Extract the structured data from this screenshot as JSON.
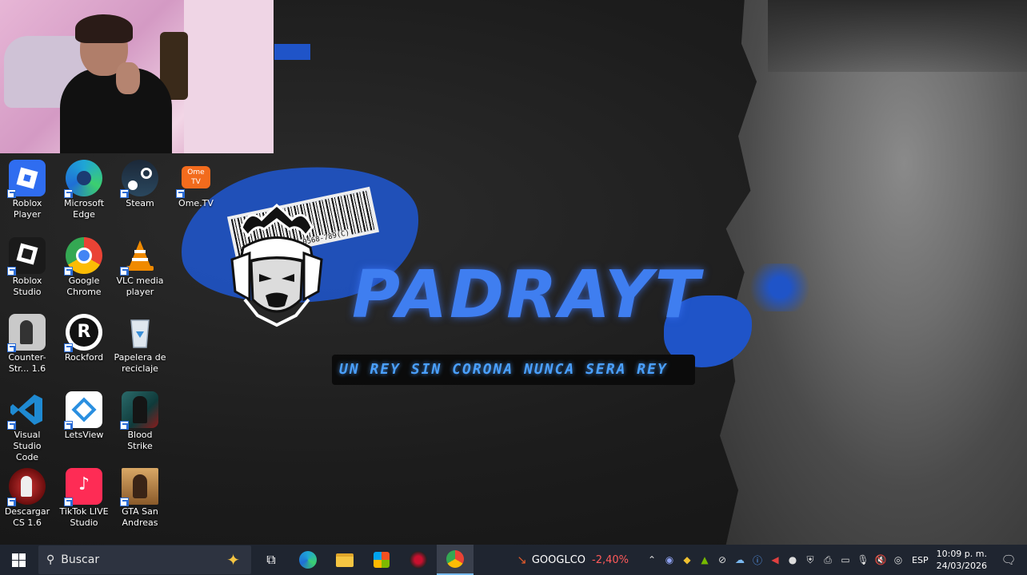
{
  "wallpaper": {
    "brand": "PADRAYT",
    "slogan": "UN REY SIN CORONA NUNCA SERA REY",
    "barcode_code": "0568-789(C)"
  },
  "desktop_icons": [
    {
      "label": "Roblox Player",
      "icon": "roblox-player-icon",
      "color": "#2f6df0"
    },
    {
      "label": "Microsoft Edge",
      "icon": "edge-icon",
      "color": "#1fa5d6"
    },
    {
      "label": "Steam",
      "icon": "steam-icon",
      "color": "#1b2838"
    },
    {
      "label": "Ome.TV",
      "icon": "ometv-icon",
      "color": "#f26b1d"
    },
    {
      "label": "Roblox Studio",
      "icon": "roblox-studio-icon",
      "color": "#1a1a1a"
    },
    {
      "label": "Google Chrome",
      "icon": "chrome-icon",
      "color": "#e0e0e0"
    },
    {
      "label": "VLC media player",
      "icon": "vlc-icon",
      "color": "#f08a00"
    },
    {
      "label": "Counter-Str... 1.6",
      "icon": "counter-strike-icon",
      "color": "#c9c9c9"
    },
    {
      "label": "Rockford",
      "icon": "rockford-icon",
      "color": "#ffffff"
    },
    {
      "label": "Papelera de reciclaje",
      "icon": "recycle-bin-icon",
      "color": "#cfd8e3"
    },
    {
      "label": "Visual Studio Code",
      "icon": "vscode-icon",
      "color": "#1f8ad2"
    },
    {
      "label": "LetsView",
      "icon": "letsview-icon",
      "color": "#ffffff"
    },
    {
      "label": "Blood Strike",
      "icon": "blood-strike-icon",
      "color": "#2b6b6b"
    },
    {
      "label": "Descargar CS 1.6",
      "icon": "cs-download-icon",
      "color": "#8a1515"
    },
    {
      "label": "TikTok LIVE Studio",
      "icon": "tiktok-live-icon",
      "color": "#fe2c55"
    },
    {
      "label": "GTA San Andreas",
      "icon": "gta-sa-icon",
      "color": "#c98f4a"
    }
  ],
  "taskbar": {
    "search_placeholder": "Buscar",
    "stock_ticker": "GOOGLCO",
    "stock_change": "-2,40%",
    "language": "ESP",
    "time": "10:09 p. m.",
    "date": "24/03/2026"
  }
}
